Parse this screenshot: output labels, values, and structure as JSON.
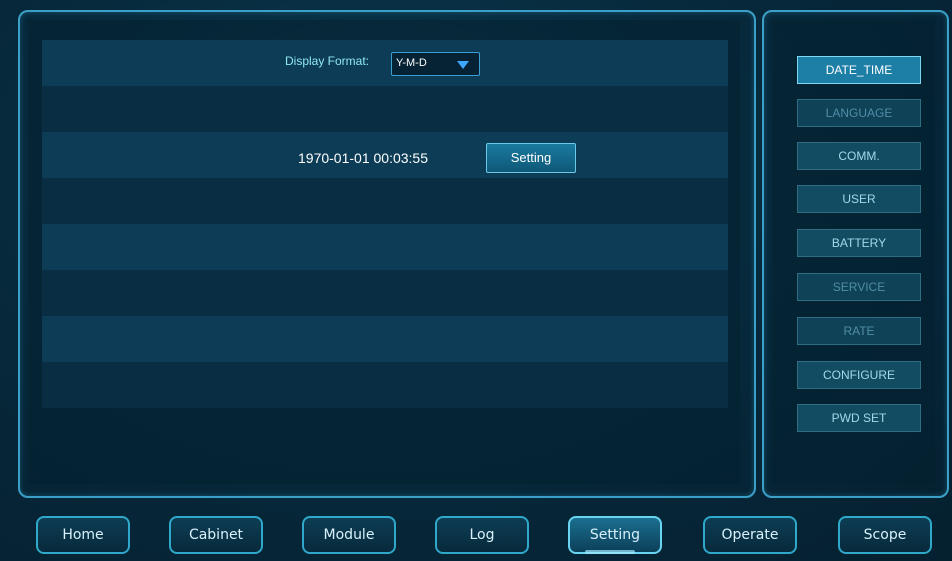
{
  "main": {
    "display_format_label": "Display Format:",
    "display_format_value": "Y-M-D",
    "datetime": "1970-01-01 00:03:55",
    "setting_button": "Setting"
  },
  "sidebar": {
    "items": [
      {
        "label": "DATE_TIME",
        "state": "active"
      },
      {
        "label": "LANGUAGE",
        "state": "dim"
      },
      {
        "label": "COMM.",
        "state": "normal"
      },
      {
        "label": "USER",
        "state": "normal"
      },
      {
        "label": "BATTERY",
        "state": "normal"
      },
      {
        "label": "SERVICE",
        "state": "dim"
      },
      {
        "label": "RATE",
        "state": "dim"
      },
      {
        "label": "CONFIGURE",
        "state": "normal"
      },
      {
        "label": "PWD SET",
        "state": "normal"
      }
    ]
  },
  "nav": {
    "items": [
      {
        "label": "Home"
      },
      {
        "label": "Cabinet"
      },
      {
        "label": "Module"
      },
      {
        "label": "Log"
      },
      {
        "label": "Setting",
        "active": true
      },
      {
        "label": "Operate"
      },
      {
        "label": "Scope"
      }
    ]
  },
  "colors": {
    "accent": "#3aa0c8",
    "active_button": "#1d7ea6",
    "background": "#072a3d"
  }
}
